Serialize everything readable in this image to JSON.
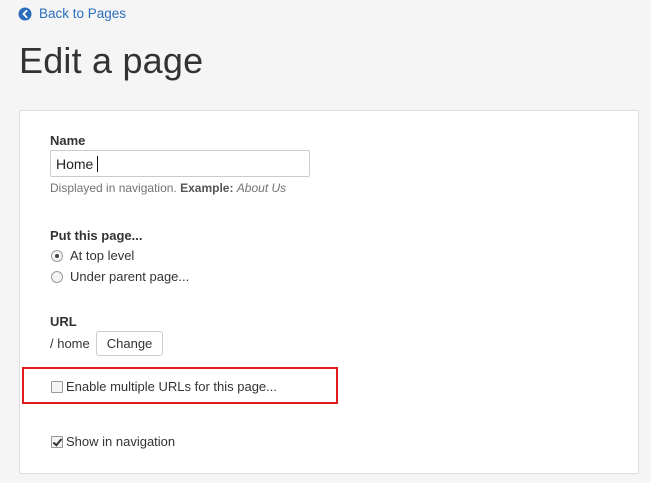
{
  "header": {
    "back_link": "Back to Pages",
    "title": "Edit a page"
  },
  "form": {
    "name": {
      "label": "Name",
      "value": "Home",
      "help_text": "Displayed in navigation.",
      "help_example_label": "Example:",
      "help_example_value": "About Us"
    },
    "placement": {
      "label": "Put this page...",
      "options": [
        "At top level",
        "Under parent page..."
      ],
      "selected": "At top level"
    },
    "url": {
      "label": "URL",
      "value": "/ home",
      "change_label": "Change"
    },
    "multiple_urls": {
      "label": "Enable multiple URLs for this page...",
      "checked": false
    },
    "show_in_navigation": {
      "label": "Show in navigation",
      "checked": true
    }
  },
  "colors": {
    "link": "#2a6ebb",
    "highlight": "#e01b1b"
  }
}
